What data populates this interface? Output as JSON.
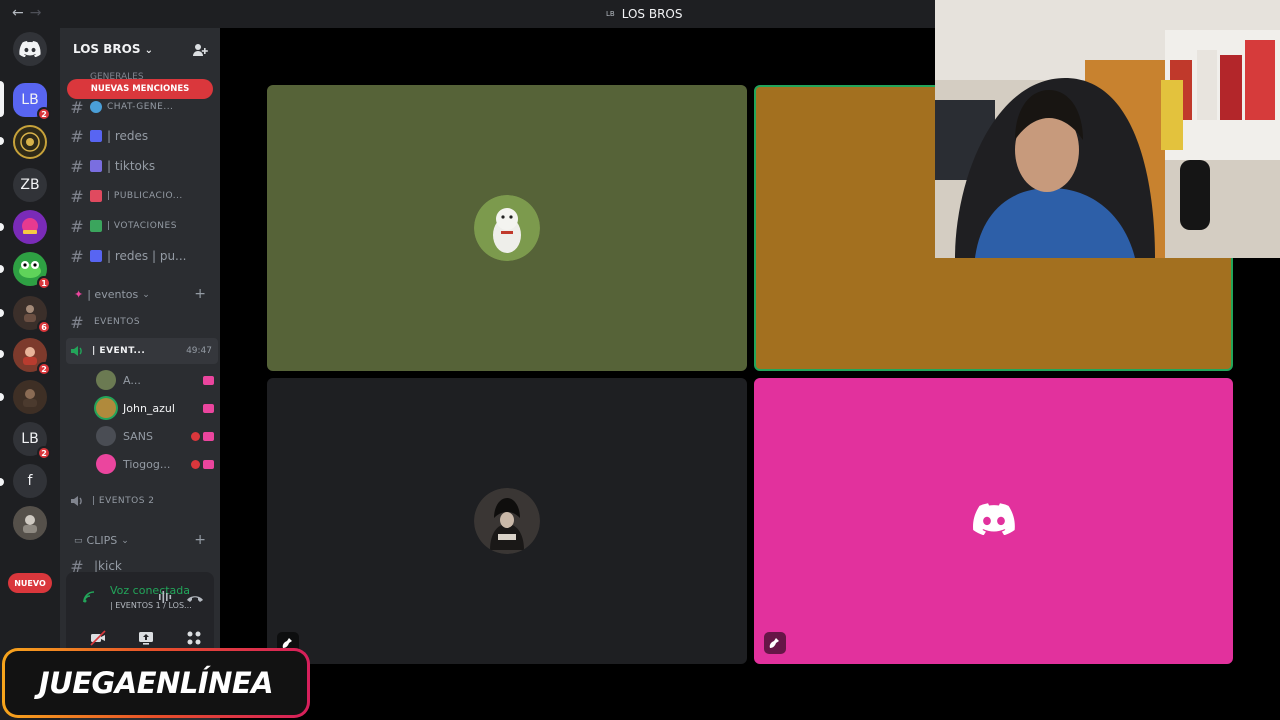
{
  "window": {
    "title": "LOS BROS",
    "title_badge": "LB",
    "back_icon": "arrow-left-icon",
    "forward_icon": "arrow-right-icon"
  },
  "rail": {
    "servers": [
      {
        "label": "",
        "icon": "discord-logo-icon"
      },
      {
        "label": "LB",
        "badge": "2"
      },
      {
        "label": ""
      },
      {
        "label": "ZB"
      },
      {
        "label": ""
      },
      {
        "label": "",
        "badge": "1"
      },
      {
        "label": "",
        "badge": "6"
      },
      {
        "label": "",
        "badge": "2"
      },
      {
        "label": ""
      },
      {
        "label": "LB",
        "badge": "2"
      },
      {
        "label": "f"
      },
      {
        "label": ""
      }
    ],
    "new_label": "NUEVO"
  },
  "sidebar": {
    "guild_name": "LOS BROS",
    "mentions_label": "NUEVAS MENCIONES",
    "category_generales": "GENERALES",
    "channels": [
      {
        "label": "CHAT-GENE...",
        "small": true
      },
      {
        "label": "| redes"
      },
      {
        "label": "| tiktoks"
      },
      {
        "label": "| PUBLICACIO...",
        "small": true
      },
      {
        "label": "| VOTACIONES",
        "small": true
      },
      {
        "label": "| redes | pu..."
      }
    ],
    "category_eventos": "| eventos",
    "text_event_channel": "EVENTOS",
    "voice_event_channel": "| EVENT...",
    "voice_timer": "49:47",
    "voice_users": [
      {
        "name": "A...",
        "avatar_color": "#6b7a52"
      },
      {
        "name": "John_azul",
        "avatar_color": "#b08a3c"
      },
      {
        "name": "SANS",
        "avatar_color": "#4a4d54"
      },
      {
        "name": "Tiogog...",
        "avatar_color": "#eb459e"
      }
    ],
    "voice_event_2": "| EVENTOS 2",
    "category_clips": "CLIPS",
    "clips_channel": "|kick"
  },
  "voice_panel": {
    "status": "Voz conectada",
    "location": "| EVENTOS 1 / LOS..."
  },
  "call": {
    "colors": {
      "tile_tl": "#566338",
      "tile_tr": "#a3701f",
      "tile_bl": "#1e1f22",
      "tile_br": "#e2319d",
      "speaking": "#23a55a"
    }
  },
  "watermark": "JUEGAENLÍNEA"
}
